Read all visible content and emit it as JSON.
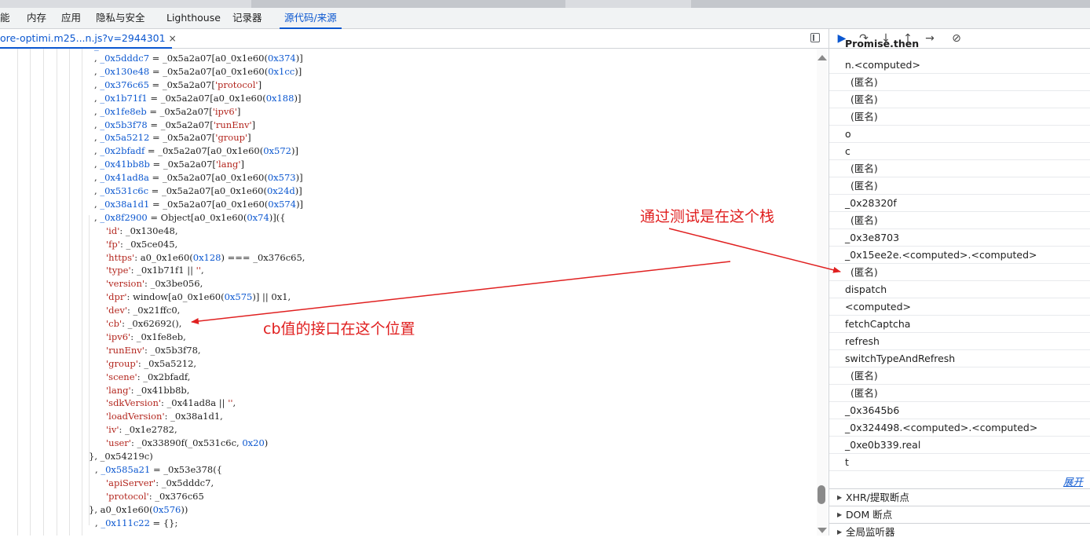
{
  "main_tabs": [
    "能",
    "内存",
    "应用",
    "隐私与安全",
    "Lighthouse",
    "记录器",
    "源代码/来源"
  ],
  "file_tab": {
    "label": "ore-optimi.m25...n.js?v=2944301",
    "close": "×"
  },
  "code": {
    "lines": [
      ", _0x5dddc7 = _0x5a2a07[a0_0x1e60(0x374)]",
      ", _0x130e48 = _0x5a2a07[a0_0x1e60(0x1cc)]",
      ", _0x376c65 = _0x5a2a07['protocol']",
      ", _0x1b71f1 = _0x5a2a07[a0_0x1e60(0x188)]",
      ", _0x1fe8eb = _0x5a2a07['ipv6']",
      ", _0x5b3f78 = _0x5a2a07['runEnv']",
      ", _0x5a5212 = _0x5a2a07['group']",
      ", _0x2bfadf = _0x5a2a07[a0_0x1e60(0x572)]",
      ", _0x41bb8b = _0x5a2a07['lang']",
      ", _0x41ad8a = _0x5a2a07[a0_0x1e60(0x573)]",
      ", _0x531c6c = _0x5a2a07[a0_0x1e60(0x24d)]",
      ", _0x38a1d1 = _0x5a2a07[a0_0x1e60(0x574)]",
      ", _0x8f2900 = Object[a0_0x1e60(0x74)]({",
      "'id': _0x130e48,",
      "'fp': _0x5ce045,",
      "'https': a0_0x1e60(0x128) === _0x376c65,",
      "'type': _0x1b71f1 || '',",
      "'version': _0x3be056,",
      "'dpr': window[a0_0x1e60(0x575)] || 0x1,",
      "'dev': _0x21ffc0,",
      "'cb': _0x62692(),",
      "'ipv6': _0x1fe8eb,",
      "'runEnv': _0x5b3f78,",
      "'group': _0x5a5212,",
      "'scene': _0x2bfadf,",
      "'lang': _0x41bb8b,",
      "'sdkVersion': _0x41ad8a || '',",
      "'loadVersion': _0x38a1d1,",
      "'iv': _0x1e2782,",
      "'user': _0x33890f(_0x531c6c, 0x20)",
      "}, _0x54219c)",
      ", _0x585a21 = _0x53e378({",
      "'apiServer': _0x5dddc7,",
      "'protocol': _0x376c65",
      "}, a0_0x1e60(0x576))",
      ", _0x111c22 = {};"
    ]
  },
  "call_stack": {
    "header_partial": "Promise.then",
    "frames": [
      {
        "label": "n.<computed>",
        "anon": false
      },
      {
        "label": "(匿名)",
        "anon": true
      },
      {
        "label": "(匿名)",
        "anon": true
      },
      {
        "label": "(匿名)",
        "anon": true
      },
      {
        "label": "o",
        "anon": false
      },
      {
        "label": "c",
        "anon": false
      },
      {
        "label": "(匿名)",
        "anon": true
      },
      {
        "label": "(匿名)",
        "anon": true
      },
      {
        "label": "_0x28320f",
        "anon": false
      },
      {
        "label": "(匿名)",
        "anon": true
      },
      {
        "label": "_0x3e8703",
        "anon": false
      },
      {
        "label": "_0x15ee2e.<computed>.<computed>",
        "anon": false
      },
      {
        "label": "(匿名)",
        "anon": true
      },
      {
        "label": "dispatch",
        "anon": false
      },
      {
        "label": "<computed>",
        "anon": false
      },
      {
        "label": "fetchCaptcha",
        "anon": false
      },
      {
        "label": "refresh",
        "anon": false
      },
      {
        "label": "switchTypeAndRefresh",
        "anon": false
      },
      {
        "label": "(匿名)",
        "anon": true
      },
      {
        "label": "(匿名)",
        "anon": true
      },
      {
        "label": "_0x3645b6",
        "anon": false
      },
      {
        "label": "_0x324498.<computed>.<computed>",
        "anon": false
      },
      {
        "label": "_0xe0b339.real",
        "anon": false
      },
      {
        "label": "t",
        "anon": false
      }
    ],
    "expand_label": "展开"
  },
  "sections": [
    "XHR/提取断点",
    "DOM 断点",
    "全局监听器"
  ],
  "annotations": {
    "stack_note": "通过测试是在这个栈",
    "cb_note": "cb值的接口在这个位置",
    "color": "#e02020"
  }
}
